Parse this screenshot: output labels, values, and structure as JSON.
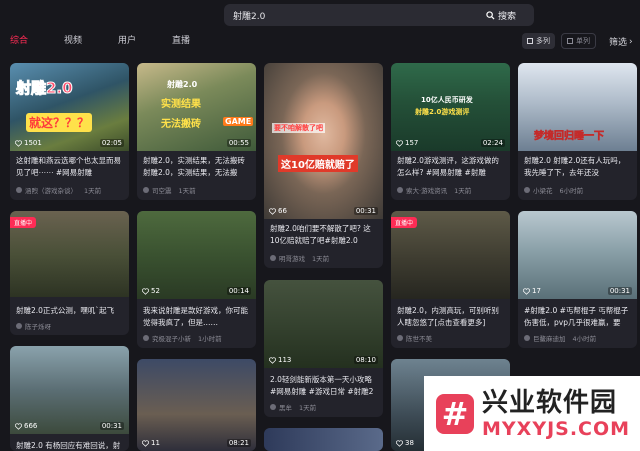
{
  "search": {
    "value": "射雕2.0",
    "button_label": "搜索"
  },
  "tabs": [
    {
      "label": "综合",
      "active": true
    },
    {
      "label": "视频",
      "active": false
    },
    {
      "label": "用户",
      "active": false
    },
    {
      "label": "直播",
      "active": false
    }
  ],
  "view": {
    "multi_label": "多列",
    "single_label": "单列",
    "filter_label": "筛选"
  },
  "cards": [
    {
      "caption": "这射雕和燕云选哪个也太显而易见了吧⋯⋯ #网易射雕",
      "author": "涵煦（游戏杂谈）",
      "time": "1天前",
      "likes": "1501",
      "duration": "02:05",
      "overlay": [
        "射雕2.0",
        "就这？？？"
      ]
    },
    {
      "caption": "射雕2.0，实测结果，无法搬砖 射雕2.0，实测结果，无法搬",
      "author": "司空震",
      "time": "1天前",
      "likes": "",
      "duration": "00:55",
      "overlay": [
        "射雕2.0",
        "实测结果",
        "无法搬砖",
        "GAME"
      ]
    },
    {
      "caption": "射雕2.0咱们要不解散了吧? 这10亿赔就赔了吧#射雕2.0",
      "author": "明哥游戏",
      "time": "1天前",
      "likes": "66",
      "duration": "00:31",
      "overlay": [
        "要不咱解散了吧",
        "这10亿赔就赔了"
      ]
    },
    {
      "caption": "射雕2.0游戏测评，这游戏做的怎么样? #网易射雕 #射雕",
      "author": "索大·游戏资讯",
      "time": "1天前",
      "likes": "157",
      "duration": "02:24",
      "overlay": [
        "10亿人民币研发",
        "射雕2.0游戏测评"
      ]
    },
    {
      "caption": "射雕2.0 射雕2.0还有人玩吗，我先睡了下，去年还没",
      "author": "小梁花",
      "time": "6小时前",
      "likes": "",
      "duration": "",
      "overlay": [
        "梦境回归睡一下"
      ]
    },
    {
      "caption": "射雕2.0正式公测，嘿叽`起飞",
      "author": "陈子烁呀",
      "time": "",
      "likes": "",
      "duration": "",
      "live": "直播中"
    },
    {
      "caption": "我来说射雕是款好游戏，你可能觉得我疯了，但是……",
      "author": "究极混子小新",
      "time": "1小时前",
      "likes": "52",
      "duration": "00:14"
    },
    {
      "caption": "射雕2.0，内测高玩，可别听别人瞎忽悠了[点击查看更多]",
      "author": "陈世不美",
      "time": "",
      "likes": "",
      "duration": "",
      "live": "直播中"
    },
    {
      "caption": "#射雕2.0 #丐帮棍子 丐帮棍子伤害低，pvp几乎很难赢，要",
      "author": "巨鳌麻迪加",
      "time": "4小时前",
      "likes": "17",
      "duration": "00:31"
    },
    {
      "caption": "2.0轻剑能新版本第一天小攻略 #网易射雕 #游戏日常 #射雕2",
      "author": "黑牟",
      "time": "1天前",
      "likes": "113",
      "duration": "08:10"
    },
    {
      "caption": "射雕2.0 有杨回应有难回说，射",
      "author": "",
      "time": "",
      "likes": "666",
      "duration": "00:31"
    },
    {
      "caption": "",
      "author": "",
      "time": "",
      "likes": "11",
      "duration": "08:21"
    },
    {
      "caption": "",
      "author": "",
      "time": "",
      "likes": "38",
      "duration": ""
    }
  ],
  "watermark": {
    "logo": "#",
    "title": "兴业软件园",
    "subtitle": "MYXYJS.COM"
  }
}
